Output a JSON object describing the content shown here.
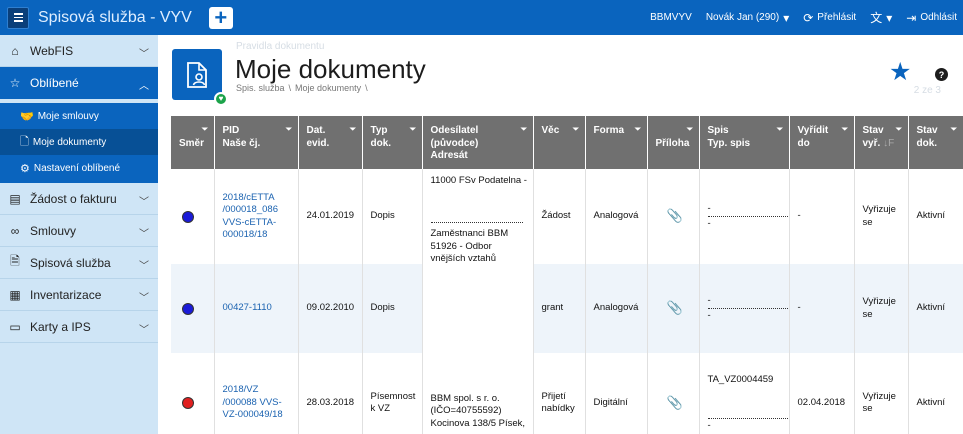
{
  "app": {
    "title": "Spisová služba - VYV"
  },
  "topbar": {
    "org": "BBMVYV",
    "user": "Novák Jan (290)",
    "overview_label": "Přehlásit",
    "logout_label": "Odhlásit"
  },
  "sidebar": {
    "items": [
      {
        "label": "WebFIS"
      },
      {
        "label": "Oblíbené"
      },
      {
        "label": "Žádost o fakturu"
      },
      {
        "label": "Smlouvy"
      },
      {
        "label": "Spisová služba"
      },
      {
        "label": "Inventarizace"
      },
      {
        "label": "Karty a IPS"
      }
    ],
    "favorites": [
      {
        "label": "Moje smlouvy"
      },
      {
        "label": "Moje dokumenty"
      },
      {
        "label": "Nastavení oblíbené"
      }
    ]
  },
  "page": {
    "title": "Moje dokumenty",
    "breadcrumb": [
      "Spis. služba",
      "Moje dokumenty"
    ],
    "ghost_text": "Pravidla dokumentu",
    "ghost_page": "2 ze 3"
  },
  "table": {
    "headers": {
      "smer": "Směr",
      "pid_1": "PID",
      "pid_2": "Naše čj.",
      "dat_1": "Dat.",
      "dat_2": "evid.",
      "typ_1": "Typ",
      "typ_2": "dok.",
      "odes_1": "Odesílatel",
      "odes_2": "(původce)",
      "odes_3": "Adresát",
      "vec": "Věc",
      "forma": "Forma",
      "priloha": "Příloha",
      "spis_1": "Spis",
      "spis_2": "Typ. spis",
      "vyr_1": "Vyřídit",
      "vyr_2": "do",
      "stavv_1": "Stav",
      "stavv_2": "vyř.",
      "stavd_1": "Stav",
      "stavd_2": "dok."
    },
    "rows": [
      {
        "dir_color": "#1b1bd8",
        "pid": "2018/cETTA /000018_086 VVS-cETTA-000018/18",
        "date": "24.01.2019",
        "type": "Dopis",
        "sender_top": "11000 FSv Podatelna -",
        "sender_bottom": "Zaměstnanci BBM 51926 - Odbor vnějších vztahů",
        "subject": "Žádost",
        "form": "Analogová",
        "spis_a": "-",
        "spis_b": "-",
        "due": "-",
        "stav_vyr": "Vyřizuje se",
        "stav_dok": "Aktivní"
      },
      {
        "dir_color": "#1b1bd8",
        "pid": "00427-1110",
        "date": "09.02.2010",
        "type": "Dopis",
        "subject": "grant",
        "form": "Analogová",
        "spis_a": "-",
        "spis_b": "-",
        "due": "-",
        "stav_vyr": "Vyřizuje se",
        "stav_dok": "Aktivní"
      },
      {
        "dir_color": "#e02020",
        "pid": "2018/VZ /000088 VVS-VZ-000049/18",
        "date": "28.03.2018",
        "type": "Písemnost k VZ",
        "sender": "BBM spol. s r. o. (IČO=40755592) Kocinova 138/5 Písek,",
        "subject": "Přijetí nabídky",
        "form": "Digitální",
        "spis_a": "TA_VZ0004459",
        "spis_b": "-",
        "due": "02.04.2018",
        "stav_vyr": "Vyřizuje se",
        "stav_dok": "Aktivní"
      }
    ]
  }
}
